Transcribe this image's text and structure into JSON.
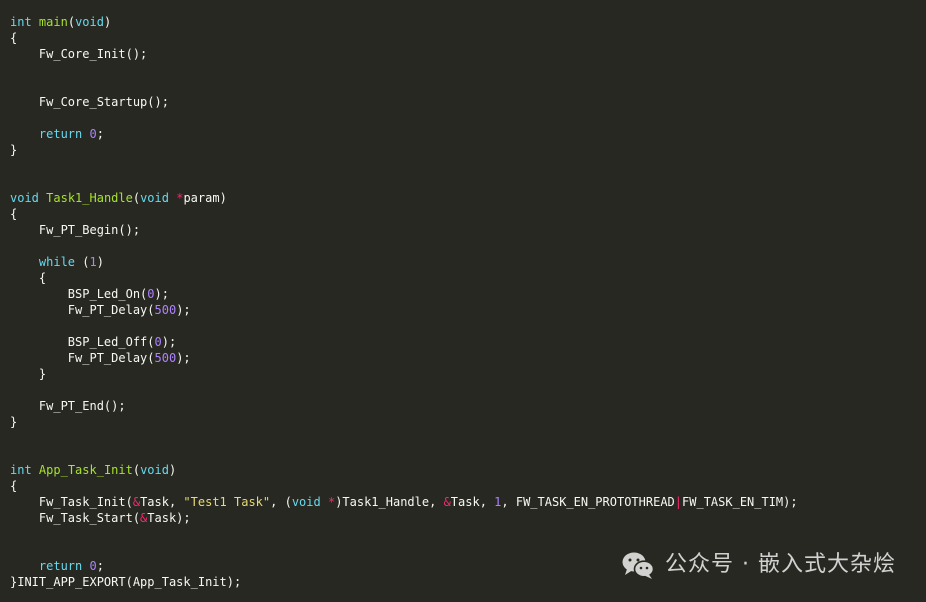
{
  "lines": [
    [
      {
        "t": "int",
        "c": "kw"
      },
      {
        "t": " "
      },
      {
        "t": "main",
        "c": "fn"
      },
      {
        "t": "("
      },
      {
        "t": "void",
        "c": "kw"
      },
      {
        "t": ")"
      }
    ],
    [
      {
        "t": "{"
      }
    ],
    [
      {
        "t": "    Fw_Core_Init();"
      }
    ],
    [],
    [],
    [
      {
        "t": "    Fw_Core_Startup();"
      }
    ],
    [],
    [
      {
        "t": "    "
      },
      {
        "t": "return",
        "c": "kw"
      },
      {
        "t": " "
      },
      {
        "t": "0",
        "c": "num"
      },
      {
        "t": ";"
      }
    ],
    [
      {
        "t": "}"
      }
    ],
    [],
    [],
    [
      {
        "t": "void",
        "c": "kw"
      },
      {
        "t": " "
      },
      {
        "t": "Task1_Handle",
        "c": "fn"
      },
      {
        "t": "("
      },
      {
        "t": "void",
        "c": "kw"
      },
      {
        "t": " "
      },
      {
        "t": "*",
        "c": "op"
      },
      {
        "t": "param)"
      }
    ],
    [
      {
        "t": "{"
      }
    ],
    [
      {
        "t": "    Fw_PT_Begin();"
      }
    ],
    [],
    [
      {
        "t": "    "
      },
      {
        "t": "while",
        "c": "kw"
      },
      {
        "t": " ("
      },
      {
        "t": "1",
        "c": "num"
      },
      {
        "t": ")"
      }
    ],
    [
      {
        "t": "    {"
      }
    ],
    [
      {
        "t": "        BSP_Led_On("
      },
      {
        "t": "0",
        "c": "num"
      },
      {
        "t": ");"
      }
    ],
    [
      {
        "t": "        Fw_PT_Delay("
      },
      {
        "t": "500",
        "c": "num"
      },
      {
        "t": ");"
      }
    ],
    [],
    [
      {
        "t": "        BSP_Led_Off("
      },
      {
        "t": "0",
        "c": "num"
      },
      {
        "t": ");"
      }
    ],
    [
      {
        "t": "        Fw_PT_Delay("
      },
      {
        "t": "500",
        "c": "num"
      },
      {
        "t": ");"
      }
    ],
    [
      {
        "t": "    }"
      }
    ],
    [],
    [
      {
        "t": "    Fw_PT_End();"
      }
    ],
    [
      {
        "t": "}"
      }
    ],
    [],
    [],
    [
      {
        "t": "int",
        "c": "kw"
      },
      {
        "t": " "
      },
      {
        "t": "App_Task_Init",
        "c": "fn"
      },
      {
        "t": "("
      },
      {
        "t": "void",
        "c": "kw"
      },
      {
        "t": ")"
      }
    ],
    [
      {
        "t": "{"
      }
    ],
    [
      {
        "t": "    Fw_Task_Init("
      },
      {
        "t": "&",
        "c": "op"
      },
      {
        "t": "Task, "
      },
      {
        "t": "\"Test1 Task\"",
        "c": "str"
      },
      {
        "t": ", ("
      },
      {
        "t": "void",
        "c": "kw"
      },
      {
        "t": " "
      },
      {
        "t": "*",
        "c": "op"
      },
      {
        "t": ")Task1_Handle, "
      },
      {
        "t": "&",
        "c": "op"
      },
      {
        "t": "Task, "
      },
      {
        "t": "1",
        "c": "num"
      },
      {
        "t": ", FW_TASK_EN_PROTOTHREAD"
      },
      {
        "t": "|",
        "c": "op"
      },
      {
        "t": "FW_TASK_EN_TIM);"
      }
    ],
    [
      {
        "t": "    Fw_Task_Start("
      },
      {
        "t": "&",
        "c": "op"
      },
      {
        "t": "Task);"
      }
    ],
    [],
    [],
    [
      {
        "t": "    "
      },
      {
        "t": "return",
        "c": "kw"
      },
      {
        "t": " "
      },
      {
        "t": "0",
        "c": "num"
      },
      {
        "t": ";"
      }
    ],
    [
      {
        "t": "}INIT_APP_EXPORT(App_Task_Init);"
      }
    ]
  ],
  "watermark": {
    "icon": "wechat-icon",
    "text": "公众号 · 嵌入式大杂烩"
  },
  "colors": {
    "background": "#272822",
    "keyword": "#66d9ef",
    "function": "#a6e22e",
    "number": "#ae81ff",
    "operator": "#f92672",
    "string": "#e6db74",
    "text": "#f8f8f2"
  }
}
